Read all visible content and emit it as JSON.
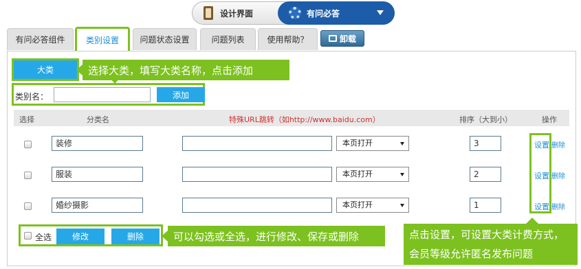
{
  "switcher": {
    "design_label": "设计界面",
    "qa_label": "有问必答"
  },
  "tabs": [
    {
      "label": "有问必答组件"
    },
    {
      "label": "类别设置"
    },
    {
      "label": "问题状态设置"
    },
    {
      "label": "问题列表"
    },
    {
      "label": "使用帮助？"
    }
  ],
  "unload_label": "卸载",
  "category": {
    "toggle_label": "大类",
    "callout": "选择大类，填写大类名称，点击添加",
    "name_label": "类别名：",
    "name_value": "",
    "add_label": "添加"
  },
  "table": {
    "headers": {
      "select": "选择",
      "name": "分类名",
      "url": "特殊URL跳转（如http://www.baidu.com）",
      "order": "排序（大到小）",
      "ops": "操作"
    },
    "rows": [
      {
        "name": "装修",
        "url": "",
        "open": "本页打开",
        "order": "3",
        "set": "设置",
        "del": "删除"
      },
      {
        "name": "服装",
        "url": "",
        "open": "本页打开",
        "order": "2",
        "set": "设置",
        "del": "删除"
      },
      {
        "name": "婚纱摄影",
        "url": "",
        "open": "本页打开",
        "order": "1",
        "set": "设置",
        "del": "删除"
      }
    ]
  },
  "footer": {
    "select_all": "全选",
    "modify": "修改",
    "delete": "删除",
    "callout": "可以勾选或全选，进行修改、保存或删除",
    "settings_note": "点击设置，可设置大类计费方式，会员等级允许匿名发布问题"
  },
  "colors": {
    "accent": "#7cc11f",
    "button": "#26a8e8",
    "switch_active": "#1c5ca8"
  }
}
